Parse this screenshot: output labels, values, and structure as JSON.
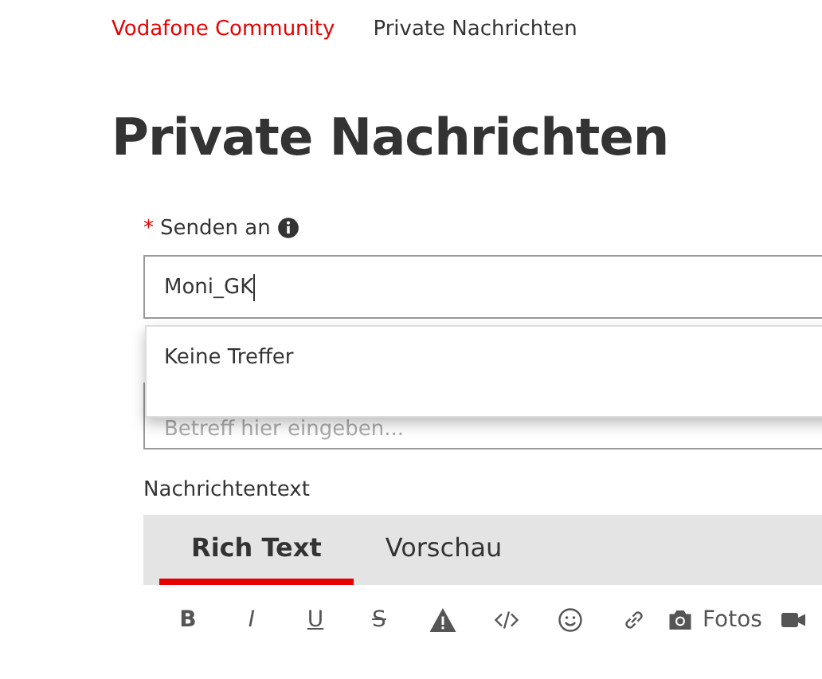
{
  "breadcrumb": [
    {
      "label": "Vodafone Community",
      "link": true
    },
    {
      "label": "Private Nachrichten",
      "link": false
    }
  ],
  "title": "Private Nachrichten",
  "recipient": {
    "required_mark": "*",
    "label": "Senden an",
    "value": "Moni_GK"
  },
  "suggestions": {
    "message": "Keine Treffer"
  },
  "subject": {
    "placeholder": "Betreff hier eingeben..."
  },
  "body_label": "Nachrichtentext",
  "tabs": [
    {
      "label": "Rich Text",
      "selected": true
    },
    {
      "label": "Vorschau",
      "selected": false
    }
  ],
  "toolbar": [
    {
      "kind": "bold",
      "label": "B"
    },
    {
      "kind": "italic",
      "label": "I"
    },
    {
      "kind": "underline",
      "label": "U"
    },
    {
      "kind": "strike",
      "label": "S"
    },
    {
      "kind": "warning"
    },
    {
      "kind": "code"
    },
    {
      "kind": "emoji"
    },
    {
      "kind": "link"
    },
    {
      "kind": "photos",
      "label": "Fotos"
    },
    {
      "kind": "video"
    }
  ]
}
